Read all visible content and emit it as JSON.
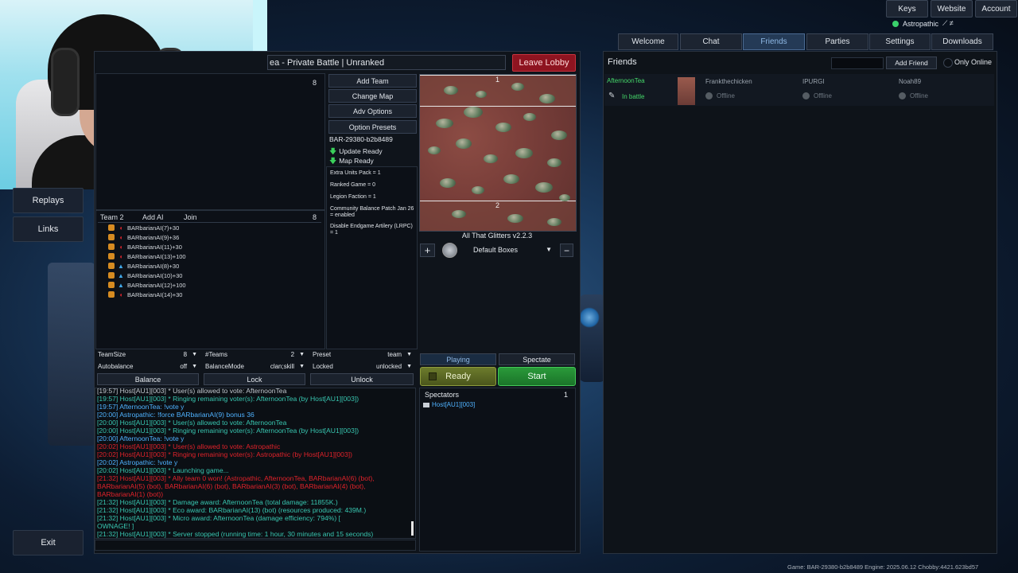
{
  "header": {
    "keys_label": "Keys",
    "website_label": "Website",
    "account_label": "Account",
    "username": "Astropathic",
    "tabs": [
      "Welcome",
      "Chat",
      "Friends",
      "Parties",
      "Settings",
      "Downloads"
    ],
    "active_tab": "Friends"
  },
  "left_nav": {
    "replays_label": "Replays",
    "links_label": "Links",
    "exit_label": "Exit"
  },
  "battle": {
    "title": "ea - Private Battle | Unranked",
    "leave_label": "Leave Lobby",
    "team1_count": "8",
    "team2": {
      "label": "Team 2",
      "add_ai_label": "Add AI",
      "join_label": "Join",
      "count": "8",
      "players": [
        {
          "name": "BARbarianAI(7)+30",
          "faction": "C"
        },
        {
          "name": "BARbarianAI(9)+36",
          "faction": "C"
        },
        {
          "name": "BARbarianAI(11)+30",
          "faction": "C"
        },
        {
          "name": "BARbarianAI(13)+100",
          "faction": "C"
        },
        {
          "name": "BARbarianAI(8)+30",
          "faction": "A"
        },
        {
          "name": "BARbarianAI(10)+30",
          "faction": "A"
        },
        {
          "name": "BARbarianAI(12)+100",
          "faction": "A"
        },
        {
          "name": "BARbarianAI(14)+30",
          "faction": "C"
        }
      ]
    },
    "buttons": {
      "add_team": "Add Team",
      "change_map": "Change Map",
      "adv_options": "Adv Options",
      "option_presets": "Option Presets"
    },
    "version": "BAR-29380-b2b8489",
    "update_ready": "Update Ready",
    "map_ready": "Map Ready",
    "options": [
      "Extra Units Pack = 1",
      "Ranked Game = 0",
      "Legion Faction = 1",
      "Community Balance Patch Jan 26 = enabled",
      "Disable Endgame Artilery (LRPC) = 1"
    ],
    "map": {
      "start_box_1": "1",
      "start_box_2": "2",
      "name": "All That Glitters v2.2.3",
      "start_boxes_label": "Default Boxes",
      "add_label": "+",
      "remove_label": "−"
    },
    "settings": {
      "teamsize_label": "TeamSize",
      "teamsize_value": "8",
      "teams_label": "#Teams",
      "teams_value": "2",
      "preset_label": "Preset",
      "preset_value": "team",
      "autobalance_label": "Autobalance",
      "autobalance_value": "off",
      "balancemode_label": "BalanceMode",
      "balancemode_value": "clan;skill",
      "locked_label": "Locked",
      "locked_value": "unlocked",
      "balance_btn": "Balance",
      "lock_btn": "Lock",
      "unlock_btn": "Unlock"
    },
    "playing_label": "Playing",
    "spectate_label": "Spectate",
    "ready_label": "Ready",
    "start_label": "Start",
    "spectators": {
      "label": "Spectators",
      "count": "1",
      "list": [
        "Host[AU1][003]"
      ]
    },
    "chat": [
      {
        "text": "[19:57] Host[AU1][003] * User(s) allowed to vote: AfternoonTea",
        "color": "grey"
      },
      {
        "text": "[19:57] Host[AU1][003] * Ringing remaining voter(s): AfternoonTea (by Host[AU1][003])",
        "color": "teal"
      },
      {
        "text": "[19:57] AfternoonTea: !vote y",
        "color": "blue"
      },
      {
        "text": "[20:00] Astropathic: !force BARbarianAI(9) bonus 36",
        "color": "blue"
      },
      {
        "text": "[20:00] Host[AU1][003] * User(s) allowed to vote: AfternoonTea",
        "color": "teal"
      },
      {
        "text": "[20:00] Host[AU1][003] * Ringing remaining voter(s): AfternoonTea (by Host[AU1][003])",
        "color": "teal"
      },
      {
        "text": "[20:00] AfternoonTea: !vote y",
        "color": "blue"
      },
      {
        "text": "[20:02] Host[AU1][003] * User(s) allowed to vote: Astropathic",
        "color": "red"
      },
      {
        "text": "[20:02] Host[AU1][003] * Ringing remaining voter(s): Astropathic (by Host[AU1][003])",
        "color": "red"
      },
      {
        "text": "[20:02] Astropathic: !vote y",
        "color": "blue"
      },
      {
        "text": "[20:02] Host[AU1][003] * Launching game...",
        "color": "teal"
      },
      {
        "text": "[21:32] Host[AU1][003] * Ally team 0 won! (Astropathic, AfternoonTea, BARbarianAI(6) (bot),",
        "color": "red"
      },
      {
        "text": "BARbarianAI(5) (bot), BARbarianAI(6) (bot), BARbarianAI(3) (bot), BARbarianAI(4) (bot),",
        "color": "red"
      },
      {
        "text": "BARbarianAI(1) (bot))",
        "color": "red"
      },
      {
        "text": "[21:32] Host[AU1][003] *    Damage award:   AfternoonTea          (total damage: 11855K.)",
        "color": "teal"
      },
      {
        "text": "[21:32] Host[AU1][003] *    Eco award:      BARbarianAI(13) (bot)  (resources produced: 439M.)",
        "color": "teal"
      },
      {
        "text": "[21:32] Host[AU1][003] *    Micro award:    AfternoonTea           (damage efficiency: 794%)    [",
        "color": "teal"
      },
      {
        "text": "OWNAGE! ]",
        "color": "teal"
      },
      {
        "text": "[21:32] Host[AU1][003] * Server stopped (running time: 1 hour, 30 minutes and 15 seconds)",
        "color": "teal"
      }
    ]
  },
  "friends": {
    "title": "Friends",
    "add_friend_label": "Add Friend",
    "only_online_label": "Only Online",
    "list": [
      {
        "name": "AfternoonTea",
        "status": "In battle"
      },
      {
        "name": "Frankthechicken",
        "status": "Offline"
      },
      {
        "name": "IPURGI",
        "status": "Offline"
      },
      {
        "name": "Noah89",
        "status": "Offline"
      }
    ]
  },
  "footer": "Game: BAR-29380-b2b8489  Engine: 2025.06.12  Chobby:4421.623bd57",
  "colors": {
    "accent": "#4a6a92",
    "leave": "#8e1420",
    "start": "#2a9a3a",
    "ready": "#6c7b2c",
    "online": "#3ad16c"
  }
}
